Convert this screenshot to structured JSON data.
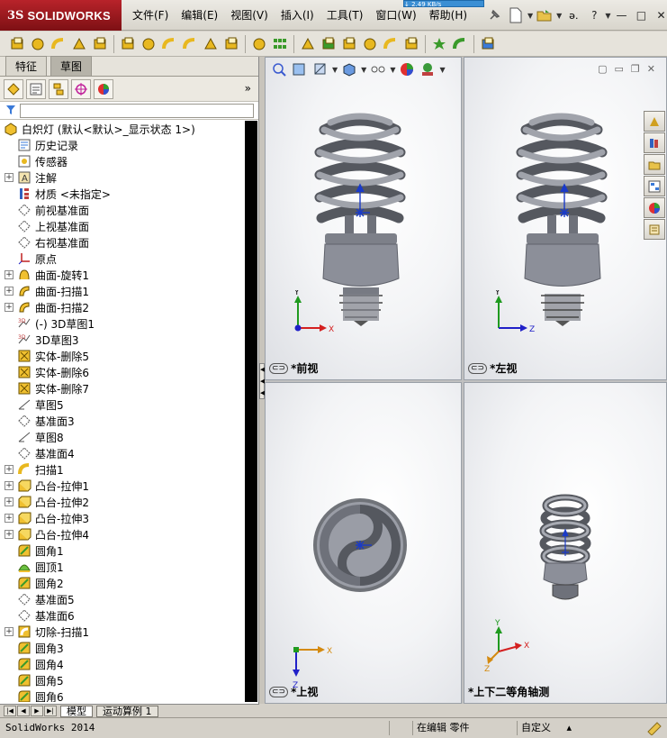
{
  "app": {
    "logo_mark": "3S",
    "logo_text": "SOLIDWORKS",
    "popup_text": "↓ 2.49 KB/s"
  },
  "menu": {
    "items": [
      "文件(F)",
      "编辑(E)",
      "视图(V)",
      "插入(I)",
      "工具(T)",
      "窗口(W)",
      "帮助(H)"
    ]
  },
  "window_controls": {
    "help": "?",
    "minimize": "—",
    "restore": "□",
    "close": "✕"
  },
  "left_panel": {
    "tabs": [
      {
        "label": "特征",
        "active": false
      },
      {
        "label": "草图",
        "active": true
      }
    ],
    "more_label": "»",
    "filter_placeholder": "",
    "tree": [
      {
        "label": "白炽灯 (默认<默认>_显示状态 1>)",
        "icon": "part-icon",
        "expandable": false,
        "indent": 0
      },
      {
        "label": "历史记录",
        "icon": "history-icon",
        "expandable": false,
        "indent": 1
      },
      {
        "label": "传感器",
        "icon": "sensor-icon",
        "expandable": false,
        "indent": 1
      },
      {
        "label": "注解",
        "icon": "annotation-icon",
        "expandable": true,
        "indent": 1
      },
      {
        "label": "材质 <未指定>",
        "icon": "material-icon",
        "expandable": false,
        "indent": 1
      },
      {
        "label": "前视基准面",
        "icon": "plane-icon",
        "expandable": false,
        "indent": 1
      },
      {
        "label": "上视基准面",
        "icon": "plane-icon",
        "expandable": false,
        "indent": 1
      },
      {
        "label": "右视基准面",
        "icon": "plane-icon",
        "expandable": false,
        "indent": 1
      },
      {
        "label": "原点",
        "icon": "origin-icon",
        "expandable": false,
        "indent": 1
      },
      {
        "label": "曲面-旋转1",
        "icon": "revolve-surface-icon",
        "expandable": true,
        "indent": 1
      },
      {
        "label": "曲面-扫描1",
        "icon": "sweep-surface-icon",
        "expandable": true,
        "indent": 1
      },
      {
        "label": "曲面-扫描2",
        "icon": "sweep-surface-icon",
        "expandable": true,
        "indent": 1
      },
      {
        "label": "(-) 3D草图1",
        "icon": "sketch3d-icon",
        "expandable": false,
        "indent": 1
      },
      {
        "label": "3D草图3",
        "icon": "sketch3d-icon",
        "expandable": false,
        "indent": 1
      },
      {
        "label": "实体-删除5",
        "icon": "delete-body-icon",
        "expandable": false,
        "indent": 1
      },
      {
        "label": "实体-删除6",
        "icon": "delete-body-icon",
        "expandable": false,
        "indent": 1
      },
      {
        "label": "实体-删除7",
        "icon": "delete-body-icon",
        "expandable": false,
        "indent": 1
      },
      {
        "label": "草图5",
        "icon": "sketch-icon",
        "expandable": false,
        "indent": 1
      },
      {
        "label": "基准面3",
        "icon": "plane-icon",
        "expandable": false,
        "indent": 1
      },
      {
        "label": "草图8",
        "icon": "sketch-icon",
        "expandable": false,
        "indent": 1
      },
      {
        "label": "基准面4",
        "icon": "plane-icon",
        "expandable": false,
        "indent": 1
      },
      {
        "label": "扫描1",
        "icon": "sweep-icon",
        "expandable": true,
        "indent": 1
      },
      {
        "label": "凸台-拉伸1",
        "icon": "extrude-icon",
        "expandable": true,
        "indent": 1
      },
      {
        "label": "凸台-拉伸2",
        "icon": "extrude-icon",
        "expandable": true,
        "indent": 1
      },
      {
        "label": "凸台-拉伸3",
        "icon": "extrude-icon",
        "expandable": true,
        "indent": 1
      },
      {
        "label": "凸台-拉伸4",
        "icon": "extrude-icon",
        "expandable": true,
        "indent": 1
      },
      {
        "label": "圆角1",
        "icon": "fillet-icon",
        "expandable": false,
        "indent": 1
      },
      {
        "label": "圆顶1",
        "icon": "dome-icon",
        "expandable": false,
        "indent": 1
      },
      {
        "label": "圆角2",
        "icon": "fillet-icon",
        "expandable": false,
        "indent": 1
      },
      {
        "label": "基准面5",
        "icon": "plane-icon",
        "expandable": false,
        "indent": 1
      },
      {
        "label": "基准面6",
        "icon": "plane-icon",
        "expandable": false,
        "indent": 1
      },
      {
        "label": "切除-扫描1",
        "icon": "cut-sweep-icon",
        "expandable": true,
        "indent": 1
      },
      {
        "label": "圆角3",
        "icon": "fillet-icon",
        "expandable": false,
        "indent": 1
      },
      {
        "label": "圆角4",
        "icon": "fillet-icon",
        "expandable": false,
        "indent": 1
      },
      {
        "label": "圆角5",
        "icon": "fillet-icon",
        "expandable": false,
        "indent": 1
      },
      {
        "label": "圆角6",
        "icon": "fillet-icon",
        "expandable": false,
        "indent": 1
      }
    ],
    "bottom_tabs": [
      {
        "label": "模型",
        "active": true
      },
      {
        "label": "运动算例 1",
        "active": false
      }
    ]
  },
  "viewports": [
    {
      "label": "*前视",
      "axes": [
        "Y",
        "X"
      ]
    },
    {
      "label": "*左视",
      "axes": [
        "Y",
        "Z"
      ]
    },
    {
      "label": "*上视",
      "axes": [
        "X",
        "Z"
      ]
    },
    {
      "label": "*上下二等角轴测",
      "axes": [
        "Y",
        "X",
        "Z"
      ]
    }
  ],
  "status_bar": {
    "app_version": "SolidWorks 2014",
    "mode": "在编辑 零件",
    "custom": "自定义",
    "custom_arrow": "▴"
  },
  "colors": {
    "brand_red": "#b8232a",
    "axis_x": "#d42020",
    "axis_y": "#1f9a1f",
    "axis_z": "#2020c8",
    "lamp_grey": "#8c8f99"
  }
}
